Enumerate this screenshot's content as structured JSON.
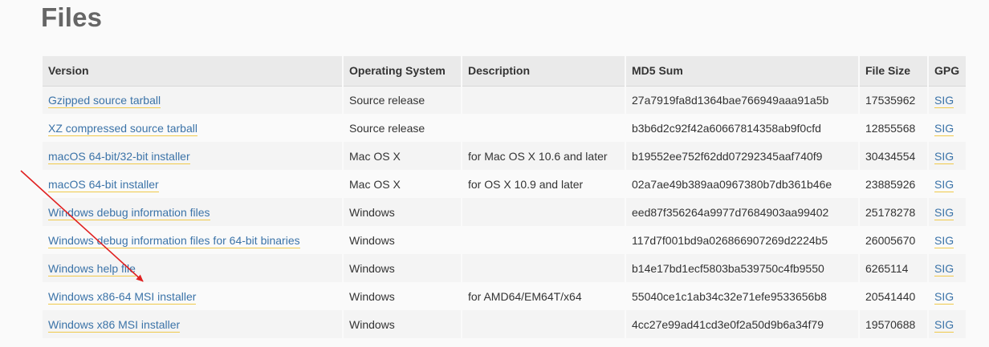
{
  "page": {
    "title": "Files"
  },
  "table": {
    "headers": [
      "Version",
      "Operating System",
      "Description",
      "MD5 Sum",
      "File Size",
      "GPG"
    ],
    "rows": [
      {
        "version": "Gzipped source tarball",
        "os": "Source release",
        "description": "",
        "md5": "27a7919fa8d1364bae766949aaa91a5b",
        "size": "17535962",
        "gpg": "SIG"
      },
      {
        "version": "XZ compressed source tarball",
        "os": "Source release",
        "description": "",
        "md5": "b3b6d2c92f42a60667814358ab9f0cfd",
        "size": "12855568",
        "gpg": "SIG"
      },
      {
        "version": "macOS 64-bit/32-bit installer",
        "os": "Mac OS X",
        "description": "for Mac OS X 10.6 and later",
        "md5": "b19552ee752f62dd07292345aaf740f9",
        "size": "30434554",
        "gpg": "SIG"
      },
      {
        "version": "macOS 64-bit installer",
        "os": "Mac OS X",
        "description": "for OS X 10.9 and later",
        "md5": "02a7ae49b389aa0967380b7db361b46e",
        "size": "23885926",
        "gpg": "SIG"
      },
      {
        "version": "Windows debug information files",
        "os": "Windows",
        "description": "",
        "md5": "eed87f356264a9977d7684903aa99402",
        "size": "25178278",
        "gpg": "SIG"
      },
      {
        "version": "Windows debug information files for 64-bit binaries",
        "os": "Windows",
        "description": "",
        "md5": "117d7f001bd9a026866907269d2224b5",
        "size": "26005670",
        "gpg": "SIG"
      },
      {
        "version": "Windows help file",
        "os": "Windows",
        "description": "",
        "md5": "b14e17bd1ecf5803ba539750c4fb9550",
        "size": "6265114",
        "gpg": "SIG"
      },
      {
        "version": "Windows x86-64 MSI installer",
        "os": "Windows",
        "description": "for AMD64/EM64T/x64",
        "md5": "55040ce1c1ab34c32e71efe9533656b8",
        "size": "20541440",
        "gpg": "SIG"
      },
      {
        "version": "Windows x86 MSI installer",
        "os": "Windows",
        "description": "",
        "md5": "4cc27e99ad41cd3e0f2a50d9b6a34f79",
        "size": "19570688",
        "gpg": "SIG"
      }
    ]
  },
  "annotation": {
    "arrow_color": "#e02020"
  },
  "colors": {
    "link": "#3b73a8",
    "link_underline": "#f0c94a"
  }
}
